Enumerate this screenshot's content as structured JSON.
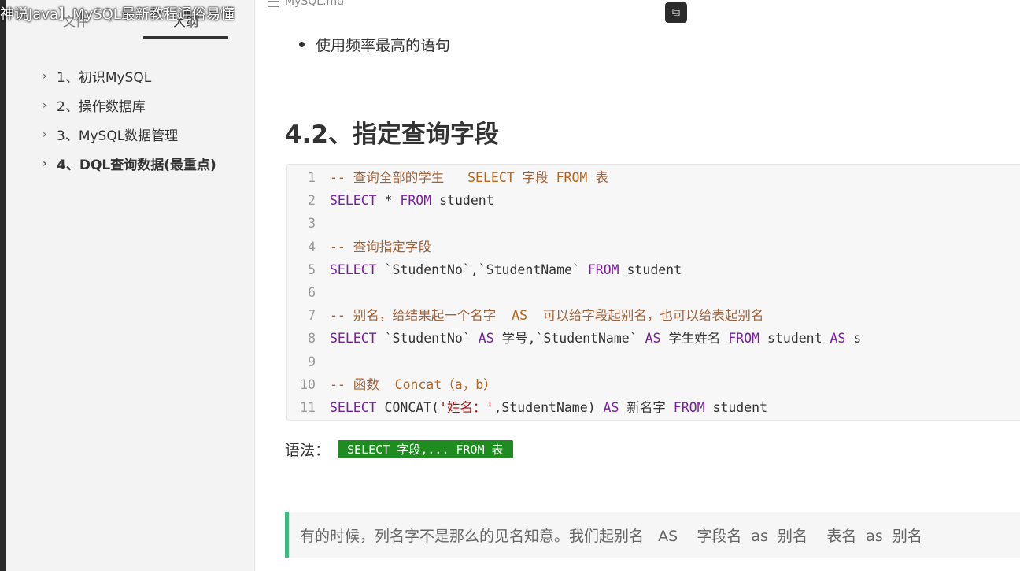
{
  "video_title": "神说Java】MySQL最新教程通俗易懂",
  "doc": {
    "file_name": "MySQL.md"
  },
  "sidebar": {
    "tabs": [
      {
        "label": "文件"
      },
      {
        "label": "大纲"
      }
    ],
    "outline": [
      {
        "label": "1、初识MySQL"
      },
      {
        "label": "2、操作数据库"
      },
      {
        "label": "3、MySQL数据管理"
      },
      {
        "label": "4、DQL查询数据(最重点)"
      }
    ]
  },
  "main": {
    "bullet": "使用频率最高的语句",
    "heading": "4.2、指定查询字段",
    "code_lines": [
      {
        "n": "1",
        "parts": [
          {
            "t": "-- 查询全部的学生   ",
            "c": "cm"
          },
          {
            "t": "SELECT",
            "c": "cmkw"
          },
          {
            "t": " 字段 ",
            "c": "cm"
          },
          {
            "t": "FROM",
            "c": "cmkw"
          },
          {
            "t": " 表",
            "c": "cm"
          }
        ]
      },
      {
        "n": "2",
        "parts": [
          {
            "t": "SELECT",
            "c": "kw"
          },
          {
            "t": " * ",
            "c": "plain"
          },
          {
            "t": "FROM",
            "c": "kw"
          },
          {
            "t": " student",
            "c": "plain"
          }
        ]
      },
      {
        "n": "3",
        "parts": []
      },
      {
        "n": "4",
        "parts": [
          {
            "t": "-- 查询指定字段",
            "c": "cm"
          }
        ]
      },
      {
        "n": "5",
        "parts": [
          {
            "t": "SELECT",
            "c": "kw"
          },
          {
            "t": " `StudentNo`,`StudentName` ",
            "c": "plain"
          },
          {
            "t": "FROM",
            "c": "kw"
          },
          {
            "t": " student",
            "c": "plain"
          }
        ]
      },
      {
        "n": "6",
        "parts": []
      },
      {
        "n": "7",
        "parts": [
          {
            "t": "-- 别名，给结果起一个名字  ",
            "c": "cm"
          },
          {
            "t": "AS",
            "c": "cmkw"
          },
          {
            "t": "  可以给字段起别名，也可以给表起别名",
            "c": "cm"
          }
        ]
      },
      {
        "n": "8",
        "parts": [
          {
            "t": "SELECT",
            "c": "kw"
          },
          {
            "t": " `StudentNo` ",
            "c": "plain"
          },
          {
            "t": "AS",
            "c": "kw"
          },
          {
            "t": " 学号,`StudentName` ",
            "c": "plain"
          },
          {
            "t": "AS",
            "c": "kw"
          },
          {
            "t": " 学生姓名 ",
            "c": "plain"
          },
          {
            "t": "FROM",
            "c": "kw"
          },
          {
            "t": " student ",
            "c": "plain"
          },
          {
            "t": "AS",
            "c": "kw"
          },
          {
            "t": " s",
            "c": "plain"
          }
        ]
      },
      {
        "n": "9",
        "parts": []
      },
      {
        "n": "10",
        "parts": [
          {
            "t": "-- 函数  ",
            "c": "cm"
          },
          {
            "t": "Concat（a，b）",
            "c": "cmkw"
          }
        ]
      },
      {
        "n": "11",
        "parts": [
          {
            "t": "SELECT",
            "c": "kw"
          },
          {
            "t": " CONCAT(",
            "c": "plain"
          },
          {
            "t": "'姓名：'",
            "c": "str"
          },
          {
            "t": ",StudentName) ",
            "c": "plain"
          },
          {
            "t": "AS",
            "c": "kw"
          },
          {
            "t": " 新名字 ",
            "c": "plain"
          },
          {
            "t": "FROM",
            "c": "kw"
          },
          {
            "t": " student",
            "c": "plain"
          }
        ]
      }
    ],
    "syntax_label": "语法：",
    "syntax_code": "SELECT 字段,... FROM 表",
    "quote": "有的时候，列名字不是那么的见名知意。我们起别名   AS    字段名  as  别名    表名  as  别名"
  },
  "colors": {
    "accent_green": "#1e8c1e",
    "quote_border": "#42b983",
    "keyword": "#7a1fa2"
  }
}
